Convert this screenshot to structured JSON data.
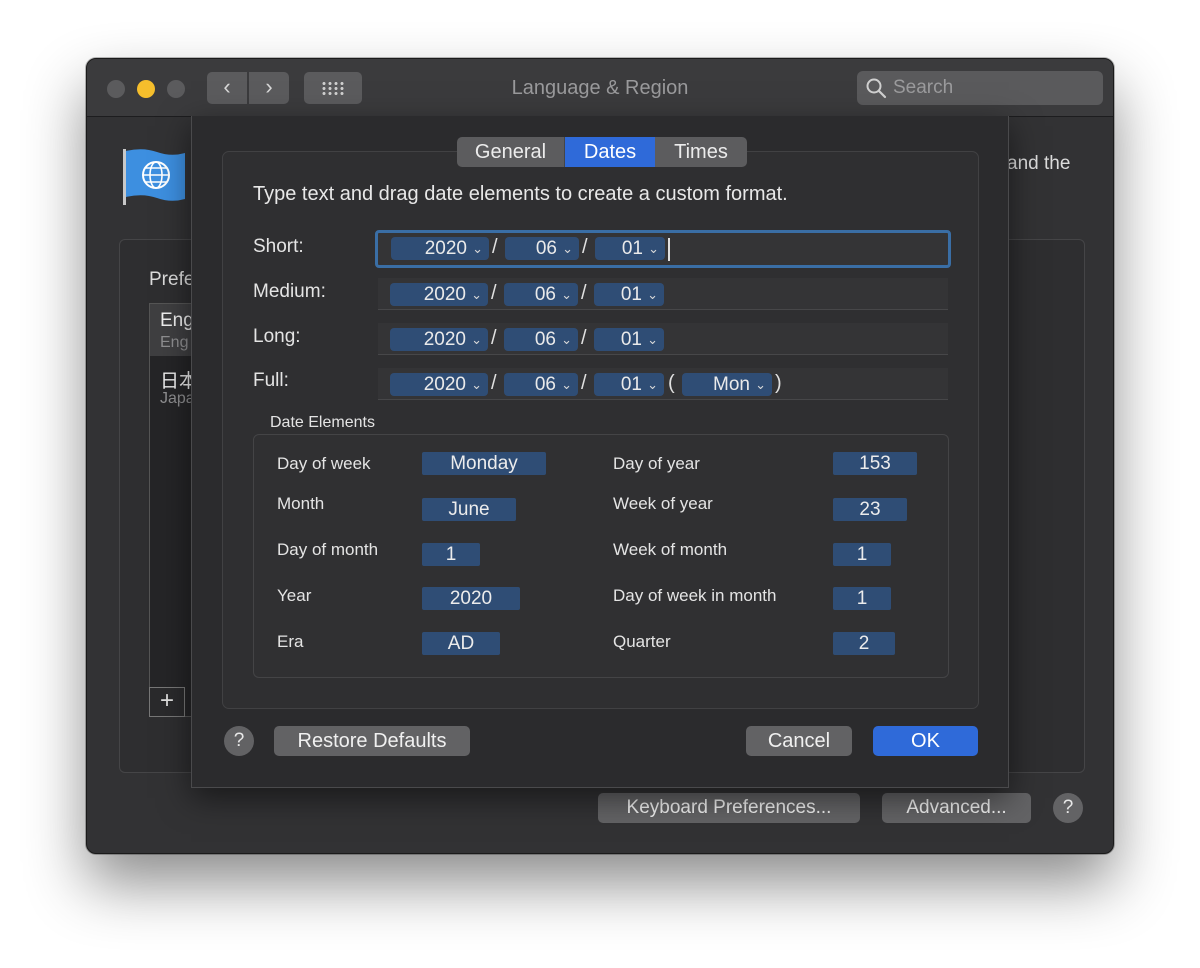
{
  "window": {
    "title": "Language & Region",
    "search_placeholder": "Search"
  },
  "background": {
    "header_fragment": "and the",
    "preferred_label_fragment": "Prefe",
    "languages": [
      {
        "name": "Eng",
        "sub": "Eng"
      },
      {
        "name": "日本",
        "sub": "Japa"
      }
    ],
    "add_label": "+",
    "keyboard_button": "Keyboard Preferences...",
    "advanced_button": "Advanced...",
    "help_label": "?"
  },
  "sheet": {
    "tabs": [
      "General",
      "Dates",
      "Times"
    ],
    "selected_tab": "Dates",
    "instruction": "Type text and drag date elements to create a custom format.",
    "formats": [
      {
        "label": "Short:",
        "tokens": [
          "2020",
          "06",
          "01"
        ],
        "separators": [
          "/",
          "/"
        ]
      },
      {
        "label": "Medium:",
        "tokens": [
          "2020",
          "06",
          "01"
        ],
        "separators": [
          "/",
          "/"
        ]
      },
      {
        "label": "Long:",
        "tokens": [
          "2020",
          "06",
          "01"
        ],
        "separators": [
          "/",
          "/"
        ]
      },
      {
        "label": "Full:",
        "tokens": [
          "2020",
          "06",
          "01",
          "Mon"
        ],
        "separators": [
          "/",
          "/",
          "(",
          ")"
        ]
      }
    ],
    "elements_title": "Date Elements",
    "elements_left": [
      {
        "label": "Day of week",
        "value": "Monday"
      },
      {
        "label": "Month",
        "value": "June"
      },
      {
        "label": "Day of month",
        "value": "1"
      },
      {
        "label": "Year",
        "value": "2020"
      },
      {
        "label": "Era",
        "value": "AD"
      }
    ],
    "elements_right": [
      {
        "label": "Day of year",
        "value": "153"
      },
      {
        "label": "Week of year",
        "value": "23"
      },
      {
        "label": "Week of month",
        "value": "1"
      },
      {
        "label": "Day of week in month",
        "value": "1"
      },
      {
        "label": "Quarter",
        "value": "2"
      }
    ],
    "help_label": "?",
    "restore_button": "Restore Defaults",
    "cancel_button": "Cancel",
    "ok_button": "OK"
  },
  "colors": {
    "accent": "#2f6ad9",
    "token": "#2f4d75",
    "focus_ring": "#3a6ea5",
    "yellow_light": "#f5be2c"
  }
}
